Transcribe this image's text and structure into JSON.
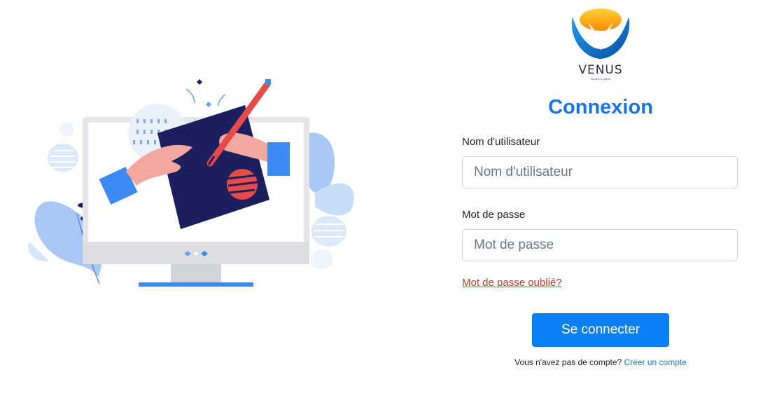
{
  "brand": {
    "name": "VENUS",
    "tagline": "Solution Logiciel"
  },
  "login": {
    "title": "Connexion",
    "username_label": "Nom d'utilisateur",
    "username_placeholder": "Nom d'utilisateur",
    "username_value": "",
    "password_label": "Mot de passe",
    "password_placeholder": "Mot de passe",
    "password_value": "",
    "forgot_link": "Mot de passe oublié?",
    "submit_label": "Se connecter",
    "signup_prompt": "Vous n'avez pas de compte?",
    "signup_link": "Créer un compte"
  },
  "colors": {
    "primary": "#1a73e8",
    "button": "#0d7ff5",
    "link_danger": "#c0392b",
    "illustration_navy": "#1c1f5e",
    "illustration_blue": "#3d8bf2"
  },
  "illustration": {
    "icon": "monitor-drawing-illustration"
  }
}
